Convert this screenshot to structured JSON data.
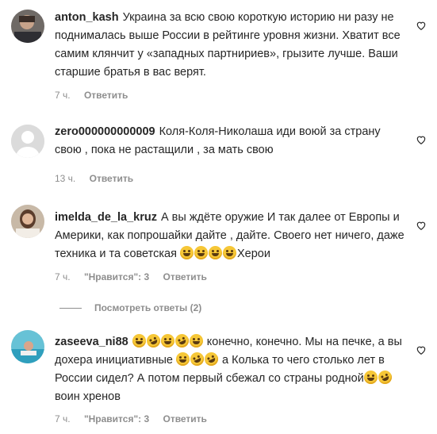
{
  "comments": [
    {
      "username": "anton_kash",
      "text": "Украина за всю свою короткую историю ни разу не поднималась выше России в рейтинге уровня жизни. Хватит все самим клянчит у «западных партнириев», грызите лучше. Ваши старшие братья в вас верят.",
      "time": "7 ч.",
      "reply_label": "Ответить"
    },
    {
      "username": "zero000000000009",
      "text": "Коля-Коля-Николаша иди воюй за страну свою , пока не растащили , за мать свою",
      "time": "13 ч.",
      "reply_label": "Ответить"
    },
    {
      "username": "imelda_de_la_kruz",
      "text_before": "А вы ждёте оружие И так далее от Европы и Америки, как попрошайки дайте , дайте. Своего нет ничего, даже техника и та советская",
      "text_after": "Херои",
      "time": "7 ч.",
      "likes": "\"Нравится\": 3",
      "reply_label": "Ответить",
      "view_replies": "Посмотреть ответы (2)"
    },
    {
      "username": "zaseeva_ni88",
      "text_a": "конечно, конечно. Мы на печке, а вы дохера инициативные",
      "text_b": "а Колька то чего столько лет в России сидел? А потом первый сбежал со страны родной",
      "text_c": "воин хренов",
      "time": "7 ч.",
      "likes": "\"Нравится\": 3",
      "reply_label": "Ответить"
    }
  ],
  "colors": {
    "text": "#262626",
    "meta": "#8e8e8e",
    "background": "#ffffff"
  },
  "icons": {
    "like": "heart-outline-icon",
    "emoji": "laughing-emoji-icon"
  }
}
